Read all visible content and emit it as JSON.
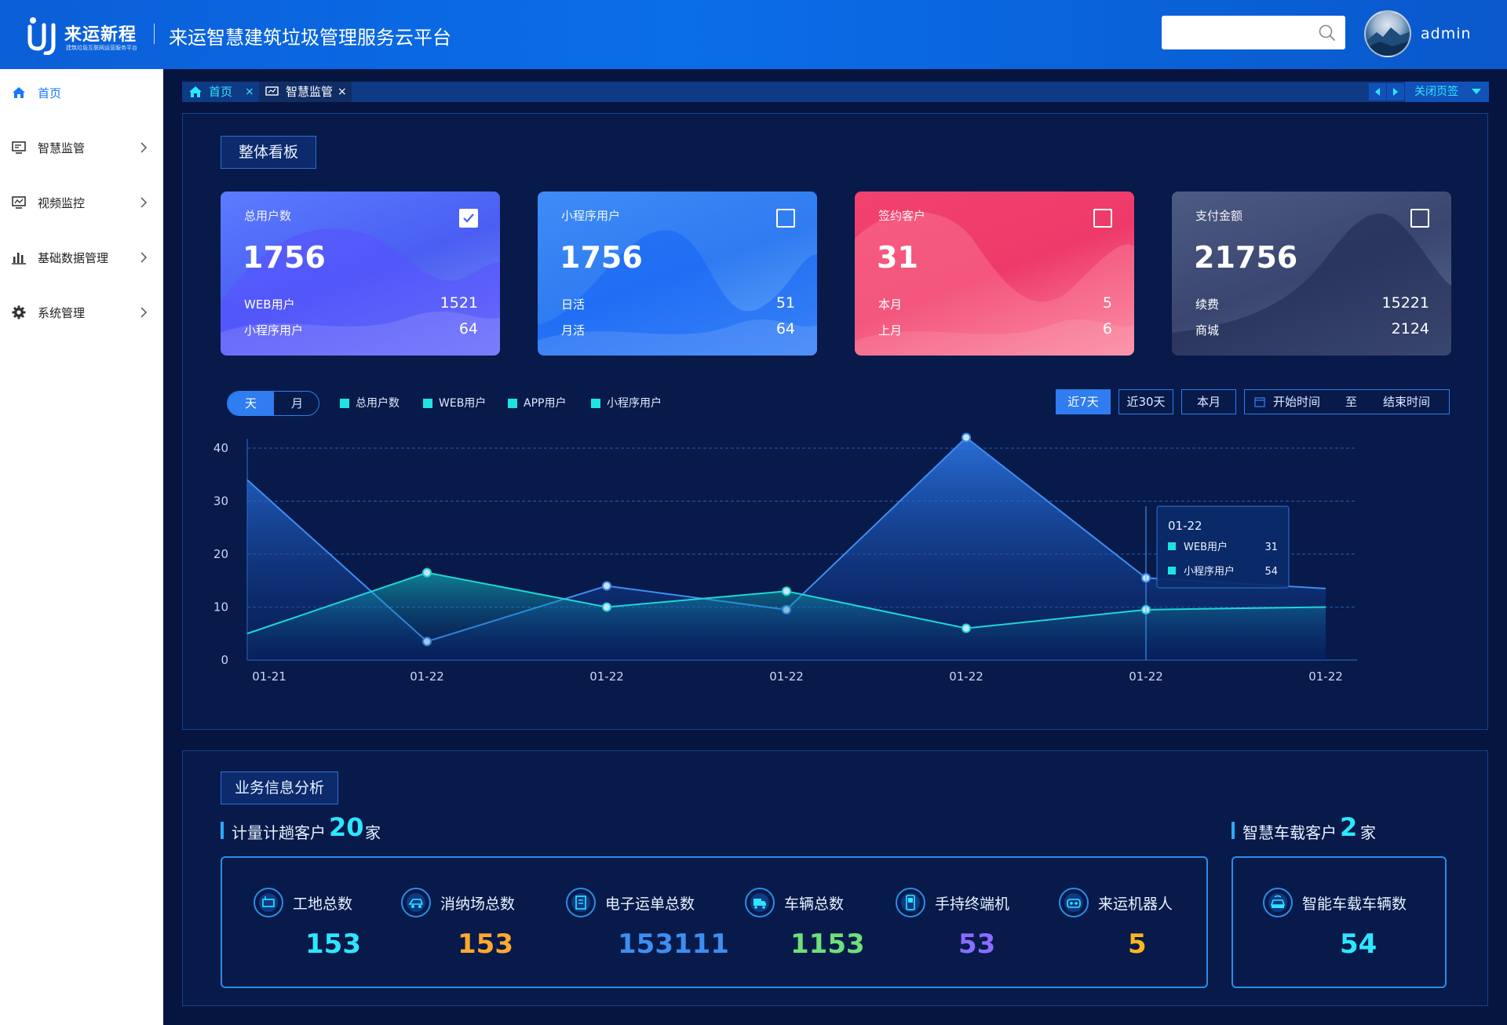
{
  "header": {
    "logo_cn": "来运新程",
    "logo_sub": "建筑垃圾互联网运营服务平台",
    "title": "来运智慧建筑垃圾管理服务云平台",
    "search_placeholder": "",
    "username": "admin"
  },
  "sidebar": {
    "items": [
      {
        "label": "首页",
        "icon": "home-icon",
        "active": true
      },
      {
        "label": "智慧监管",
        "icon": "monitor-icon"
      },
      {
        "label": "视频监控",
        "icon": "video-monitor-icon"
      },
      {
        "label": "基础数据管理",
        "icon": "bar-chart-icon"
      },
      {
        "label": "系统管理",
        "icon": "gear-icon"
      }
    ]
  },
  "tabs": {
    "items": [
      {
        "label": "首页",
        "icon": "home-icon",
        "close": "×"
      },
      {
        "label": "智慧监管",
        "icon": "monitor-icon",
        "close": "×"
      }
    ],
    "close_all": "关闭页签"
  },
  "overview": {
    "title": "整体看板",
    "cards": [
      {
        "title": "总用户数",
        "value": "1756",
        "l1": "WEB用户",
        "v1": "1521",
        "l2": "小程序用户",
        "v2": "64",
        "checked": true
      },
      {
        "title": "小程序用户",
        "value": "1756",
        "l1": "日活",
        "v1": "51",
        "l2": "月活",
        "v2": "64",
        "checked": false
      },
      {
        "title": "签约客户",
        "value": "31",
        "l1": "本月",
        "v1": "5",
        "l2": "上月",
        "v2": "6",
        "checked": false
      },
      {
        "title": "支付金额",
        "value": "21756",
        "l1": "续费",
        "v1": "15221",
        "l2": "商城",
        "v2": "2124",
        "checked": false
      }
    ],
    "segment": {
      "day": "天",
      "month": "月"
    },
    "legend": [
      "总用户数",
      "WEB用户",
      "APP用户",
      "小程序用户"
    ],
    "ranges": [
      "近7天",
      "近30天",
      "本月"
    ],
    "daterange": {
      "start": "开始时间",
      "to": "至",
      "end": "结束时间"
    }
  },
  "chart_data": {
    "type": "area",
    "categories": [
      "01-21",
      "01-22",
      "01-22",
      "01-22",
      "01-22",
      "01-22",
      "01-22"
    ],
    "ylim": [
      0,
      40
    ],
    "yticks": [
      "0",
      "10",
      "20",
      "30",
      "40"
    ],
    "grid": true,
    "series": [
      {
        "name": "WEB用户",
        "color": "#3d8ef0",
        "values": [
          34,
          3.5,
          14,
          9.5,
          42,
          15.5,
          13.5
        ]
      },
      {
        "name": "小程序用户",
        "color": "#1ed6d6",
        "values": [
          5,
          16.5,
          10,
          13,
          6,
          9.5,
          10
        ]
      }
    ],
    "tooltip": {
      "date": "01-22",
      "rows": [
        {
          "label": "WEB用户",
          "value": "31"
        },
        {
          "label": "小程序用户",
          "value": "54"
        }
      ]
    }
  },
  "business": {
    "title": "业务信息分析",
    "left": {
      "label": "计量计趟客户",
      "count": "20",
      "unit": "家",
      "stats": [
        {
          "label": "工地总数",
          "value": "153",
          "color": "#2ee6ff",
          "icon": "construction-site-icon"
        },
        {
          "label": "消纳场总数",
          "value": "153",
          "color": "#ffa92e",
          "icon": "disposal-site-icon"
        },
        {
          "label": "电子运单总数",
          "value": "153111",
          "color": "#3d8ef0",
          "icon": "waybill-icon"
        },
        {
          "label": "车辆总数",
          "value": "1153",
          "color": "#6ee07a",
          "icon": "truck-icon"
        },
        {
          "label": "手持终端机",
          "value": "53",
          "color": "#8b6cff",
          "icon": "handheld-terminal-icon"
        },
        {
          "label": "来运机器人",
          "value": "5",
          "color": "#ffb61e",
          "icon": "robot-icon"
        }
      ]
    },
    "right": {
      "label": "智慧车载客户",
      "count": "2",
      "unit": "家",
      "stats": [
        {
          "label": "智能车载车辆数",
          "value": "54",
          "color": "#2ee6ff",
          "icon": "smart-vehicle-icon"
        }
      ]
    }
  }
}
